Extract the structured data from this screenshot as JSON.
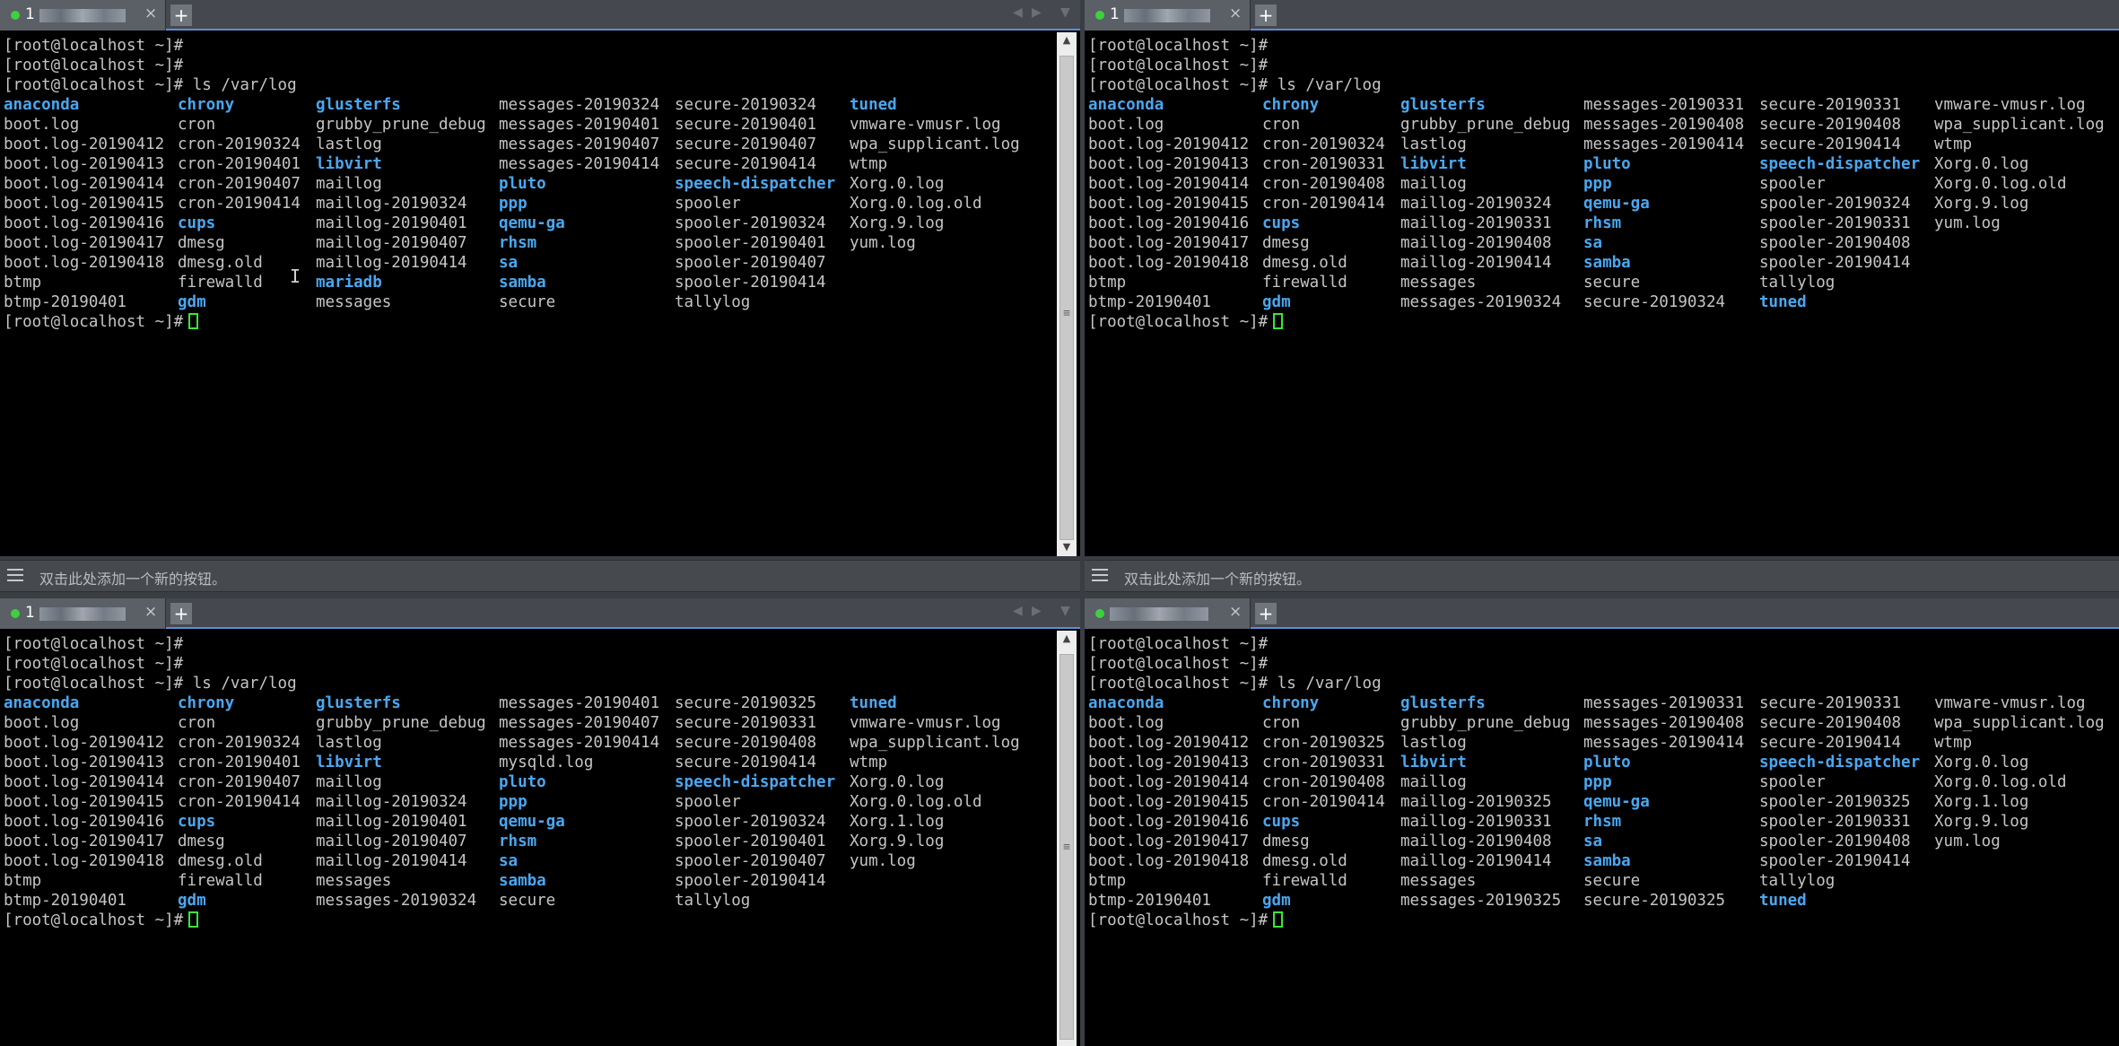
{
  "panes": [
    {
      "tab": {
        "title": "1",
        "close": "×",
        "add": "+"
      },
      "prompt_lines": [
        "[root@localhost ~]#",
        "[root@localhost ~]#",
        "[root@localhost ~]# ls /var/log"
      ],
      "rows": [
        [
          {
            "t": "anaconda",
            "d": true
          },
          {
            "t": "chrony",
            "d": true
          },
          {
            "t": "glusterfs",
            "d": true
          },
          {
            "t": "messages-20190324"
          },
          {
            "t": "secure-20190324"
          },
          {
            "t": "tuned",
            "d": true
          }
        ],
        [
          {
            "t": "boot.log"
          },
          {
            "t": "cron"
          },
          {
            "t": "grubby_prune_debug"
          },
          {
            "t": "messages-20190401"
          },
          {
            "t": "secure-20190401"
          },
          {
            "t": "vmware-vmusr.log"
          }
        ],
        [
          {
            "t": "boot.log-20190412"
          },
          {
            "t": "cron-20190324"
          },
          {
            "t": "lastlog"
          },
          {
            "t": "messages-20190407"
          },
          {
            "t": "secure-20190407"
          },
          {
            "t": "wpa_supplicant.log"
          }
        ],
        [
          {
            "t": "boot.log-20190413"
          },
          {
            "t": "cron-20190401"
          },
          {
            "t": "libvirt",
            "d": true
          },
          {
            "t": "messages-20190414"
          },
          {
            "t": "secure-20190414"
          },
          {
            "t": "wtmp"
          }
        ],
        [
          {
            "t": "boot.log-20190414"
          },
          {
            "t": "cron-20190407"
          },
          {
            "t": "maillog"
          },
          {
            "t": "pluto",
            "d": true
          },
          {
            "t": "speech-dispatcher",
            "d": true
          },
          {
            "t": "Xorg.0.log"
          }
        ],
        [
          {
            "t": "boot.log-20190415"
          },
          {
            "t": "cron-20190414"
          },
          {
            "t": "maillog-20190324"
          },
          {
            "t": "ppp",
            "d": true
          },
          {
            "t": "spooler"
          },
          {
            "t": "Xorg.0.log.old"
          }
        ],
        [
          {
            "t": "boot.log-20190416"
          },
          {
            "t": "cups",
            "d": true
          },
          {
            "t": "maillog-20190401"
          },
          {
            "t": "qemu-ga",
            "d": true
          },
          {
            "t": "spooler-20190324"
          },
          {
            "t": "Xorg.9.log"
          }
        ],
        [
          {
            "t": "boot.log-20190417"
          },
          {
            "t": "dmesg"
          },
          {
            "t": "maillog-20190407"
          },
          {
            "t": "rhsm",
            "d": true
          },
          {
            "t": "spooler-20190401"
          },
          {
            "t": "yum.log"
          }
        ],
        [
          {
            "t": "boot.log-20190418"
          },
          {
            "t": "dmesg.old"
          },
          {
            "t": "maillog-20190414"
          },
          {
            "t": "sa",
            "d": true
          },
          {
            "t": "spooler-20190407"
          },
          {
            "t": ""
          }
        ],
        [
          {
            "t": "btmp"
          },
          {
            "t": "firewalld"
          },
          {
            "t": "mariadb",
            "d": true
          },
          {
            "t": "samba",
            "d": true
          },
          {
            "t": "spooler-20190414"
          },
          {
            "t": ""
          }
        ],
        [
          {
            "t": "btmp-20190401"
          },
          {
            "t": "gdm",
            "d": true
          },
          {
            "t": "messages"
          },
          {
            "t": "secure"
          },
          {
            "t": "tallylog"
          },
          {
            "t": ""
          }
        ]
      ],
      "final_prompt": "[root@localhost ~]#"
    },
    {
      "tab": {
        "title": "1",
        "close": "×",
        "add": "+"
      },
      "prompt_lines": [
        "[root@localhost ~]#",
        "[root@localhost ~]#",
        "[root@localhost ~]# ls /var/log"
      ],
      "rows": [
        [
          {
            "t": "anaconda",
            "d": true
          },
          {
            "t": "chrony",
            "d": true
          },
          {
            "t": "glusterfs",
            "d": true
          },
          {
            "t": "messages-20190331"
          },
          {
            "t": "secure-20190331"
          },
          {
            "t": "vmware-vmusr.log"
          }
        ],
        [
          {
            "t": "boot.log"
          },
          {
            "t": "cron"
          },
          {
            "t": "grubby_prune_debug"
          },
          {
            "t": "messages-20190408"
          },
          {
            "t": "secure-20190408"
          },
          {
            "t": "wpa_supplicant.log"
          }
        ],
        [
          {
            "t": "boot.log-20190412"
          },
          {
            "t": "cron-20190324"
          },
          {
            "t": "lastlog"
          },
          {
            "t": "messages-20190414"
          },
          {
            "t": "secure-20190414"
          },
          {
            "t": "wtmp"
          }
        ],
        [
          {
            "t": "boot.log-20190413"
          },
          {
            "t": "cron-20190331"
          },
          {
            "t": "libvirt",
            "d": true
          },
          {
            "t": "pluto",
            "d": true
          },
          {
            "t": "speech-dispatcher",
            "d": true
          },
          {
            "t": "Xorg.0.log"
          }
        ],
        [
          {
            "t": "boot.log-20190414"
          },
          {
            "t": "cron-20190408"
          },
          {
            "t": "maillog"
          },
          {
            "t": "ppp",
            "d": true
          },
          {
            "t": "spooler"
          },
          {
            "t": "Xorg.0.log.old"
          }
        ],
        [
          {
            "t": "boot.log-20190415"
          },
          {
            "t": "cron-20190414"
          },
          {
            "t": "maillog-20190324"
          },
          {
            "t": "qemu-ga",
            "d": true
          },
          {
            "t": "spooler-20190324"
          },
          {
            "t": "Xorg.9.log"
          }
        ],
        [
          {
            "t": "boot.log-20190416"
          },
          {
            "t": "cups",
            "d": true
          },
          {
            "t": "maillog-20190331"
          },
          {
            "t": "rhsm",
            "d": true
          },
          {
            "t": "spooler-20190331"
          },
          {
            "t": "yum.log"
          }
        ],
        [
          {
            "t": "boot.log-20190417"
          },
          {
            "t": "dmesg"
          },
          {
            "t": "maillog-20190408"
          },
          {
            "t": "sa",
            "d": true
          },
          {
            "t": "spooler-20190408"
          },
          {
            "t": ""
          }
        ],
        [
          {
            "t": "boot.log-20190418"
          },
          {
            "t": "dmesg.old"
          },
          {
            "t": "maillog-20190414"
          },
          {
            "t": "samba",
            "d": true
          },
          {
            "t": "spooler-20190414"
          },
          {
            "t": ""
          }
        ],
        [
          {
            "t": "btmp"
          },
          {
            "t": "firewalld"
          },
          {
            "t": "messages"
          },
          {
            "t": "secure"
          },
          {
            "t": "tallylog"
          },
          {
            "t": ""
          }
        ],
        [
          {
            "t": "btmp-20190401"
          },
          {
            "t": "gdm",
            "d": true
          },
          {
            "t": "messages-20190324"
          },
          {
            "t": "secure-20190324"
          },
          {
            "t": "tuned",
            "d": true
          },
          {
            "t": ""
          }
        ]
      ],
      "final_prompt": "[root@localhost ~]#"
    },
    {
      "tab": {
        "title": "1",
        "close": "×",
        "add": "+"
      },
      "prompt_lines": [
        "[root@localhost ~]#",
        "[root@localhost ~]#",
        "[root@localhost ~]# ls /var/log"
      ],
      "rows": [
        [
          {
            "t": "anaconda",
            "d": true
          },
          {
            "t": "chrony",
            "d": true
          },
          {
            "t": "glusterfs",
            "d": true
          },
          {
            "t": "messages-20190401"
          },
          {
            "t": "secure-20190325"
          },
          {
            "t": "tuned",
            "d": true
          }
        ],
        [
          {
            "t": "boot.log"
          },
          {
            "t": "cron"
          },
          {
            "t": "grubby_prune_debug"
          },
          {
            "t": "messages-20190407"
          },
          {
            "t": "secure-20190331"
          },
          {
            "t": "vmware-vmusr.log"
          }
        ],
        [
          {
            "t": "boot.log-20190412"
          },
          {
            "t": "cron-20190324"
          },
          {
            "t": "lastlog"
          },
          {
            "t": "messages-20190414"
          },
          {
            "t": "secure-20190408"
          },
          {
            "t": "wpa_supplicant.log"
          }
        ],
        [
          {
            "t": "boot.log-20190413"
          },
          {
            "t": "cron-20190401"
          },
          {
            "t": "libvirt",
            "d": true
          },
          {
            "t": "mysqld.log"
          },
          {
            "t": "secure-20190414"
          },
          {
            "t": "wtmp"
          }
        ],
        [
          {
            "t": "boot.log-20190414"
          },
          {
            "t": "cron-20190407"
          },
          {
            "t": "maillog"
          },
          {
            "t": "pluto",
            "d": true
          },
          {
            "t": "speech-dispatcher",
            "d": true
          },
          {
            "t": "Xorg.0.log"
          }
        ],
        [
          {
            "t": "boot.log-20190415"
          },
          {
            "t": "cron-20190414"
          },
          {
            "t": "maillog-20190324"
          },
          {
            "t": "ppp",
            "d": true
          },
          {
            "t": "spooler"
          },
          {
            "t": "Xorg.0.log.old"
          }
        ],
        [
          {
            "t": "boot.log-20190416"
          },
          {
            "t": "cups",
            "d": true
          },
          {
            "t": "maillog-20190401"
          },
          {
            "t": "qemu-ga",
            "d": true
          },
          {
            "t": "spooler-20190324"
          },
          {
            "t": "Xorg.1.log"
          }
        ],
        [
          {
            "t": "boot.log-20190417"
          },
          {
            "t": "dmesg"
          },
          {
            "t": "maillog-20190407"
          },
          {
            "t": "rhsm",
            "d": true
          },
          {
            "t": "spooler-20190401"
          },
          {
            "t": "Xorg.9.log"
          }
        ],
        [
          {
            "t": "boot.log-20190418"
          },
          {
            "t": "dmesg.old"
          },
          {
            "t": "maillog-20190414"
          },
          {
            "t": "sa",
            "d": true
          },
          {
            "t": "spooler-20190407"
          },
          {
            "t": "yum.log"
          }
        ],
        [
          {
            "t": "btmp"
          },
          {
            "t": "firewalld"
          },
          {
            "t": "messages"
          },
          {
            "t": "samba",
            "d": true
          },
          {
            "t": "spooler-20190414"
          },
          {
            "t": ""
          }
        ],
        [
          {
            "t": "btmp-20190401"
          },
          {
            "t": "gdm",
            "d": true
          },
          {
            "t": "messages-20190324"
          },
          {
            "t": "secure"
          },
          {
            "t": "tallylog"
          },
          {
            "t": ""
          }
        ]
      ],
      "final_prompt": "[root@localhost ~]#"
    },
    {
      "tab": {
        "title": "",
        "close": "×",
        "add": "+"
      },
      "prompt_lines": [
        "[root@localhost ~]#",
        "[root@localhost ~]#",
        "[root@localhost ~]# ls /var/log"
      ],
      "rows": [
        [
          {
            "t": "anaconda",
            "d": true
          },
          {
            "t": "chrony",
            "d": true
          },
          {
            "t": "glusterfs",
            "d": true
          },
          {
            "t": "messages-20190331"
          },
          {
            "t": "secure-20190331"
          },
          {
            "t": "vmware-vmusr.log"
          }
        ],
        [
          {
            "t": "boot.log"
          },
          {
            "t": "cron"
          },
          {
            "t": "grubby_prune_debug"
          },
          {
            "t": "messages-20190408"
          },
          {
            "t": "secure-20190408"
          },
          {
            "t": "wpa_supplicant.log"
          }
        ],
        [
          {
            "t": "boot.log-20190412"
          },
          {
            "t": "cron-20190325"
          },
          {
            "t": "lastlog"
          },
          {
            "t": "messages-20190414"
          },
          {
            "t": "secure-20190414"
          },
          {
            "t": "wtmp"
          }
        ],
        [
          {
            "t": "boot.log-20190413"
          },
          {
            "t": "cron-20190331"
          },
          {
            "t": "libvirt",
            "d": true
          },
          {
            "t": "pluto",
            "d": true
          },
          {
            "t": "speech-dispatcher",
            "d": true
          },
          {
            "t": "Xorg.0.log"
          }
        ],
        [
          {
            "t": "boot.log-20190414"
          },
          {
            "t": "cron-20190408"
          },
          {
            "t": "maillog"
          },
          {
            "t": "ppp",
            "d": true
          },
          {
            "t": "spooler"
          },
          {
            "t": "Xorg.0.log.old"
          }
        ],
        [
          {
            "t": "boot.log-20190415"
          },
          {
            "t": "cron-20190414"
          },
          {
            "t": "maillog-20190325"
          },
          {
            "t": "qemu-ga",
            "d": true
          },
          {
            "t": "spooler-20190325"
          },
          {
            "t": "Xorg.1.log"
          }
        ],
        [
          {
            "t": "boot.log-20190416"
          },
          {
            "t": "cups",
            "d": true
          },
          {
            "t": "maillog-20190331"
          },
          {
            "t": "rhsm",
            "d": true
          },
          {
            "t": "spooler-20190331"
          },
          {
            "t": "Xorg.9.log"
          }
        ],
        [
          {
            "t": "boot.log-20190417"
          },
          {
            "t": "dmesg"
          },
          {
            "t": "maillog-20190408"
          },
          {
            "t": "sa",
            "d": true
          },
          {
            "t": "spooler-20190408"
          },
          {
            "t": "yum.log"
          }
        ],
        [
          {
            "t": "boot.log-20190418"
          },
          {
            "t": "dmesg.old"
          },
          {
            "t": "maillog-20190414"
          },
          {
            "t": "samba",
            "d": true
          },
          {
            "t": "spooler-20190414"
          },
          {
            "t": ""
          }
        ],
        [
          {
            "t": "btmp"
          },
          {
            "t": "firewalld"
          },
          {
            "t": "messages"
          },
          {
            "t": "secure"
          },
          {
            "t": "tallylog"
          },
          {
            "t": ""
          }
        ],
        [
          {
            "t": "btmp-20190401"
          },
          {
            "t": "gdm",
            "d": true
          },
          {
            "t": "messages-20190325"
          },
          {
            "t": "secure-20190325"
          },
          {
            "t": "tuned",
            "d": true
          },
          {
            "t": ""
          }
        ]
      ],
      "final_prompt": "[root@localhost ~]#"
    }
  ],
  "buttonbar": {
    "label": "双击此处添加一个新的按钮。"
  },
  "colors": {
    "directory": "#4aa7f0",
    "text": "#c5c5c5",
    "cursor": "#39e639",
    "tab_active_dot": "#3ed13e",
    "accent": "#5a8fd6"
  },
  "icons": {
    "nav_prev": "◀",
    "nav_next": "▶",
    "nav_menu": "▼",
    "scroll_up": "▲",
    "scroll_down": "▼",
    "scroll_grip": "≡",
    "text_cursor": "I"
  }
}
